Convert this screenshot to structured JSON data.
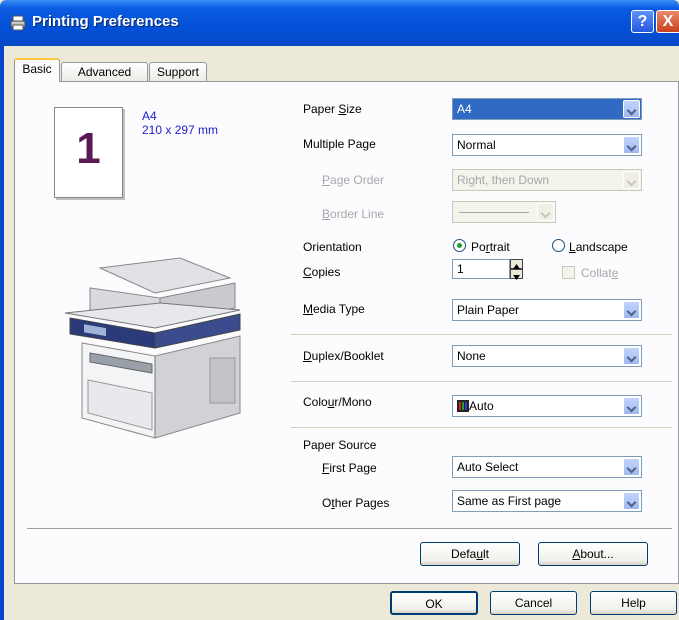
{
  "window": {
    "title": "Printing Preferences",
    "help_glyph": "?",
    "close_glyph": "X"
  },
  "tabs": [
    {
      "label": "Basic",
      "active": true
    },
    {
      "label": "Advanced",
      "active": false
    },
    {
      "label": "Support",
      "active": false
    }
  ],
  "preview": {
    "page_number": "1",
    "paper_name": "A4",
    "paper_dims": "210 x 297 mm"
  },
  "settings": {
    "paper_size": {
      "label_pre": "Paper ",
      "label_key": "S",
      "label_post": "ize",
      "value": "A4"
    },
    "multiple_page": {
      "label_pre": "Multiple Pa",
      "label_key": "g",
      "label_post": "e",
      "value": "Normal"
    },
    "page_order": {
      "label_pre": "",
      "label_key": "P",
      "label_post": "age Order",
      "value": "Right, then Down"
    },
    "border_line": {
      "label_pre": "",
      "label_key": "B",
      "label_post": "order Line",
      "value": ""
    },
    "orientation": {
      "label": "Orientation",
      "portrait_pre": "Po",
      "portrait_key": "r",
      "portrait_post": "trait",
      "landscape_pre": "",
      "landscape_key": "L",
      "landscape_post": "andscape",
      "selected": "Portrait"
    },
    "copies": {
      "label_pre": "",
      "label_key": "C",
      "label_post": "opies",
      "value": "1",
      "collate_pre": "Collat",
      "collate_key": "e",
      "collate_post": ""
    },
    "media_type": {
      "label_pre": "",
      "label_key": "M",
      "label_post": "edia Type",
      "value": "Plain Paper"
    },
    "duplex": {
      "label_pre": "",
      "label_key": "D",
      "label_post": "uplex/Booklet",
      "value": "None"
    },
    "colour_mono": {
      "label_pre": "Colo",
      "label_key": "u",
      "label_post": "r/Mono",
      "value": "Auto",
      "icon": "colour-icon"
    },
    "paper_source": {
      "label": "Paper Source",
      "first_page": {
        "label_pre": "",
        "label_key": "F",
        "label_post": "irst Page",
        "value": "Auto Select"
      },
      "other_pages": {
        "label_pre": "O",
        "label_key": "t",
        "label_post": "her Pages",
        "value": "Same as First page"
      }
    }
  },
  "buttons": {
    "default": {
      "pre": "Defa",
      "key": "u",
      "post": "lt"
    },
    "about": {
      "pre": "",
      "key": "A",
      "post": "bout..."
    },
    "ok": "OK",
    "cancel": "Cancel",
    "help": "Help"
  },
  "colors": {
    "title_bar": "#0250D8",
    "dialog_bg": "#ECE9D8",
    "selection": "#316AC5",
    "paper_info": "#2020D0"
  }
}
